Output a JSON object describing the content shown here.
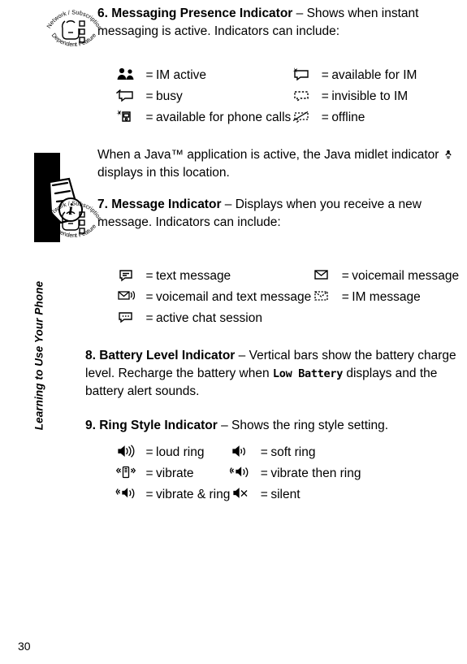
{
  "sidebar": {
    "chapter_label": "Learning to Use Your Phone"
  },
  "page_number": "30",
  "sections": [
    {
      "id": "messaging-presence",
      "heading": "6. Messaging Presence Indicator",
      "dash": "–",
      "body": "Shows when instant messaging is active. Indicators can include:",
      "icon_note": "Network / Subscription Dependent Feature",
      "table": [
        {
          "icon": "im-active-icon",
          "eq": "=",
          "label": "IM active"
        },
        {
          "icon": "available-for-im-icon",
          "eq": "=",
          "label": "available for IM"
        },
        {
          "icon": "busy-icon",
          "eq": "=",
          "label": "busy"
        },
        {
          "icon": "invisible-to-im-icon",
          "eq": "=",
          "label": "invisible to IM"
        },
        {
          "icon": "available-for-phone-calls-icon",
          "eq": "=",
          "label": "available for phone calls"
        },
        {
          "icon": "offline-icon",
          "eq": "=",
          "label": "offline"
        }
      ]
    },
    {
      "id": "java-note",
      "text_before": "When a Java™ application is active, the Java midlet indicator",
      "text_after": "displays in this location."
    },
    {
      "id": "message-indicator",
      "heading": "7. Message Indicator",
      "dash": "–",
      "body": "Displays when you receive a new message. Indicators can include:",
      "icon_note": "Network / Subscription Dependent Feature",
      "table": [
        {
          "icon": "text-message-icon",
          "eq": "=",
          "label": "text message"
        },
        {
          "icon": "voicemail-message-icon",
          "eq": "=",
          "label": "voicemail message"
        },
        {
          "icon": "voicemail-and-text-message-icon",
          "eq": "=",
          "label": "voicemail and text message"
        },
        {
          "icon": "im-message-icon",
          "eq": "=",
          "label": "IM message"
        },
        {
          "icon": "active-chat-session-icon",
          "eq": "=",
          "label": "active chat session"
        }
      ]
    },
    {
      "id": "battery-level",
      "heading": "8. Battery Level Indicator",
      "dash": "–",
      "body_part1": "Vertical bars show the battery charge level. Recharge the battery when",
      "lcd_text": "Low Battery",
      "body_part2": "displays and the battery alert sounds."
    },
    {
      "id": "ring-style",
      "heading": "9. Ring Style Indicator",
      "dash": "–",
      "body": "Shows the ring style setting.",
      "table": [
        {
          "icon": "loud-ring-icon",
          "eq": "=",
          "label": "loud ring"
        },
        {
          "icon": "soft-ring-icon",
          "eq": "=",
          "label": "soft ring"
        },
        {
          "icon": "vibrate-icon",
          "eq": "=",
          "label": "vibrate"
        },
        {
          "icon": "vibrate-then-ring-icon",
          "eq": "=",
          "label": "vibrate then ring"
        },
        {
          "icon": "vibrate-and-ring-icon",
          "eq": "=",
          "label": "vibrate & ring"
        },
        {
          "icon": "silent-icon",
          "eq": "=",
          "label": "silent"
        }
      ]
    }
  ]
}
